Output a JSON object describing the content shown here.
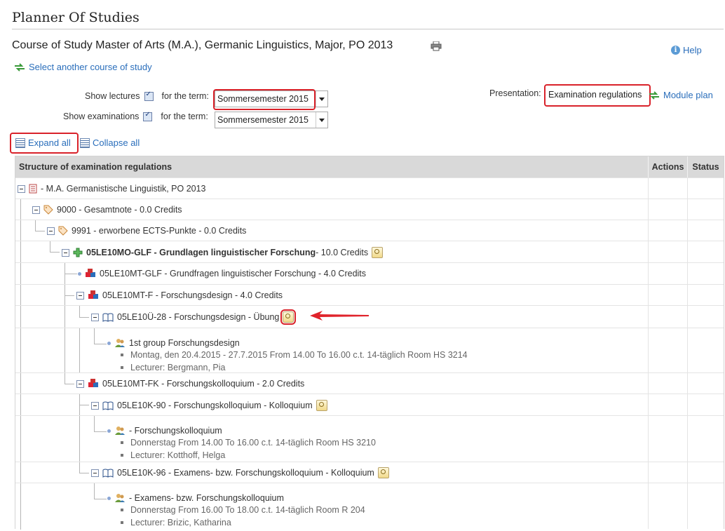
{
  "page_title": "Planner Of Studies",
  "course_title": "Course of Study Master of Arts (M.A.), Germanic Linguistics, Major, PO 2013",
  "help_label": "Help",
  "select_course_label": "Select another course of study",
  "filters": {
    "show_lectures_label": "Show lectures",
    "show_examinations_label": "Show examinations",
    "for_term_label": "for the term:",
    "lectures_term_value": "Sommersemester 2015",
    "examinations_term_value": "Sommersemester 2015"
  },
  "presentation": {
    "label": "Presentation:",
    "value": "Examination regulations",
    "module_plan_label": "Module plan"
  },
  "expand_all_label": "Expand all",
  "collapse_all_label": "Collapse all",
  "table": {
    "headers": [
      "Structure of examination regulations",
      "Actions",
      "Status"
    ],
    "rows": [
      {
        "text": "- M.A. Germanistische Linguistik, PO 2013",
        "icon": "document-icon"
      },
      {
        "text": "9000 - Gesamtnote - 0.0 Credits",
        "icon": "tag-icon"
      },
      {
        "text": "9991 - erworbene ECTS-Punkte - 0.0 Credits",
        "icon": "tag-icon"
      },
      {
        "text": "05LE10MO-GLF - Grundlagen linguistischer Forschung",
        "credits": " - 10.0 Credits",
        "icon": "module-plus-icon"
      },
      {
        "text": "05LE10MT-GLF - Grundfragen linguistischer Forschung - 4.0 Credits",
        "icon": "cubes-icon"
      },
      {
        "text": "05LE10MT-F - Forschungsdesign - 4.0 Credits",
        "icon": "cubes-icon"
      },
      {
        "text": "05LE10Ü-28 - Forschungsdesign - Übung",
        "icon": "book-icon"
      },
      {
        "text": "1st group Forschungsdesign",
        "details": [
          "Montag, den 20.4.2015 - 27.7.2015 From 14.00 To 16.00 c.t. 14-täglich Room HS 3214",
          "Lecturer: Bergmann, Pia"
        ],
        "icon": "group-icon"
      },
      {
        "text": "05LE10MT-FK - Forschungskolloquium - 2.0 Credits",
        "icon": "cubes-icon"
      },
      {
        "text": "05LE10K-90 - Forschungskolloquium - Kolloquium",
        "icon": "book-icon"
      },
      {
        "text": "- Forschungskolloquium",
        "details": [
          "Donnerstag From 14.00 To 16.00 c.t. 14-täglich Room HS 3210",
          "Lecturer: Kotthoff, Helga"
        ],
        "icon": "group-icon"
      },
      {
        "text": "05LE10K-96 - Examens- bzw. Forschungskolloquium - Kolloquium",
        "icon": "book-icon"
      },
      {
        "text": "- Examens- bzw. Forschungskolloquium",
        "details": [
          "Donnerstag From 16.00 To 18.00 c.t. 14-täglich Room R 204",
          "Lecturer: Brizic, Katharina"
        ],
        "icon": "group-icon"
      }
    ]
  },
  "colors": {
    "link": "#2a6ebb",
    "highlight": "#d9222a",
    "header_bg": "#d9d9d9"
  }
}
